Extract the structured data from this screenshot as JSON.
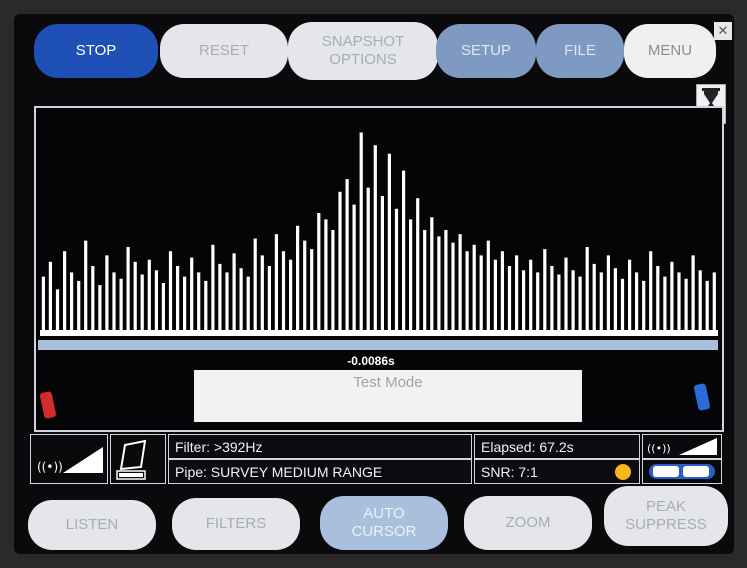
{
  "top_buttons": {
    "stop": "STOP",
    "reset": "RESET",
    "snapshot": "SNAPSHOT\nOPTIONS",
    "setup": "SETUP",
    "file": "FILE",
    "menu": "MENU"
  },
  "chart": {
    "cursor_time": "-0.0086s",
    "mode": "Test Mode",
    "colors": {
      "spectrum": "#ffffff",
      "bar": "#a9c0dc",
      "background": "#050508"
    },
    "chart_data": {
      "type": "bar",
      "title": "",
      "bins": 96,
      "values": [
        0.28,
        0.35,
        0.22,
        0.4,
        0.3,
        0.26,
        0.45,
        0.33,
        0.24,
        0.38,
        0.3,
        0.27,
        0.42,
        0.35,
        0.29,
        0.36,
        0.31,
        0.25,
        0.4,
        0.33,
        0.28,
        0.37,
        0.3,
        0.26,
        0.43,
        0.34,
        0.3,
        0.39,
        0.32,
        0.28,
        0.46,
        0.38,
        0.33,
        0.48,
        0.4,
        0.36,
        0.52,
        0.45,
        0.41,
        0.58,
        0.55,
        0.5,
        0.68,
        0.74,
        0.62,
        0.96,
        0.7,
        0.9,
        0.66,
        0.86,
        0.6,
        0.78,
        0.55,
        0.65,
        0.5,
        0.56,
        0.47,
        0.5,
        0.44,
        0.48,
        0.4,
        0.43,
        0.38,
        0.45,
        0.36,
        0.4,
        0.33,
        0.38,
        0.31,
        0.36,
        0.3,
        0.41,
        0.33,
        0.29,
        0.37,
        0.31,
        0.28,
        0.42,
        0.34,
        0.3,
        0.38,
        0.32,
        0.27,
        0.36,
        0.3,
        0.26,
        0.4,
        0.33,
        0.28,
        0.35,
        0.3,
        0.27,
        0.38,
        0.31,
        0.26,
        0.3
      ],
      "ylim": [
        0,
        1
      ]
    }
  },
  "status": {
    "filter": "Filter: >392Hz",
    "pipe": "Pipe: SURVEY MEDIUM RANGE",
    "elapsed": "Elapsed: 67.2s",
    "snr": "SNR: 7:1",
    "snr_indicator_color": "#f6b61c",
    "icons": [
      "left-signal-strength-icon",
      "battery-icon",
      "right-signal-strength-icon",
      "ground-mode-icon",
      "left-sensor-icon",
      "right-sensor-icon",
      "hourglass-icon",
      "close-icon"
    ]
  },
  "bottom_buttons": {
    "listen": "LISTEN",
    "filters": "FILTERS",
    "auto_cursor": "AUTO\nCURSOR",
    "zoom": "ZOOM",
    "peak_suppress": "PEAK\nSUPPRESS"
  }
}
